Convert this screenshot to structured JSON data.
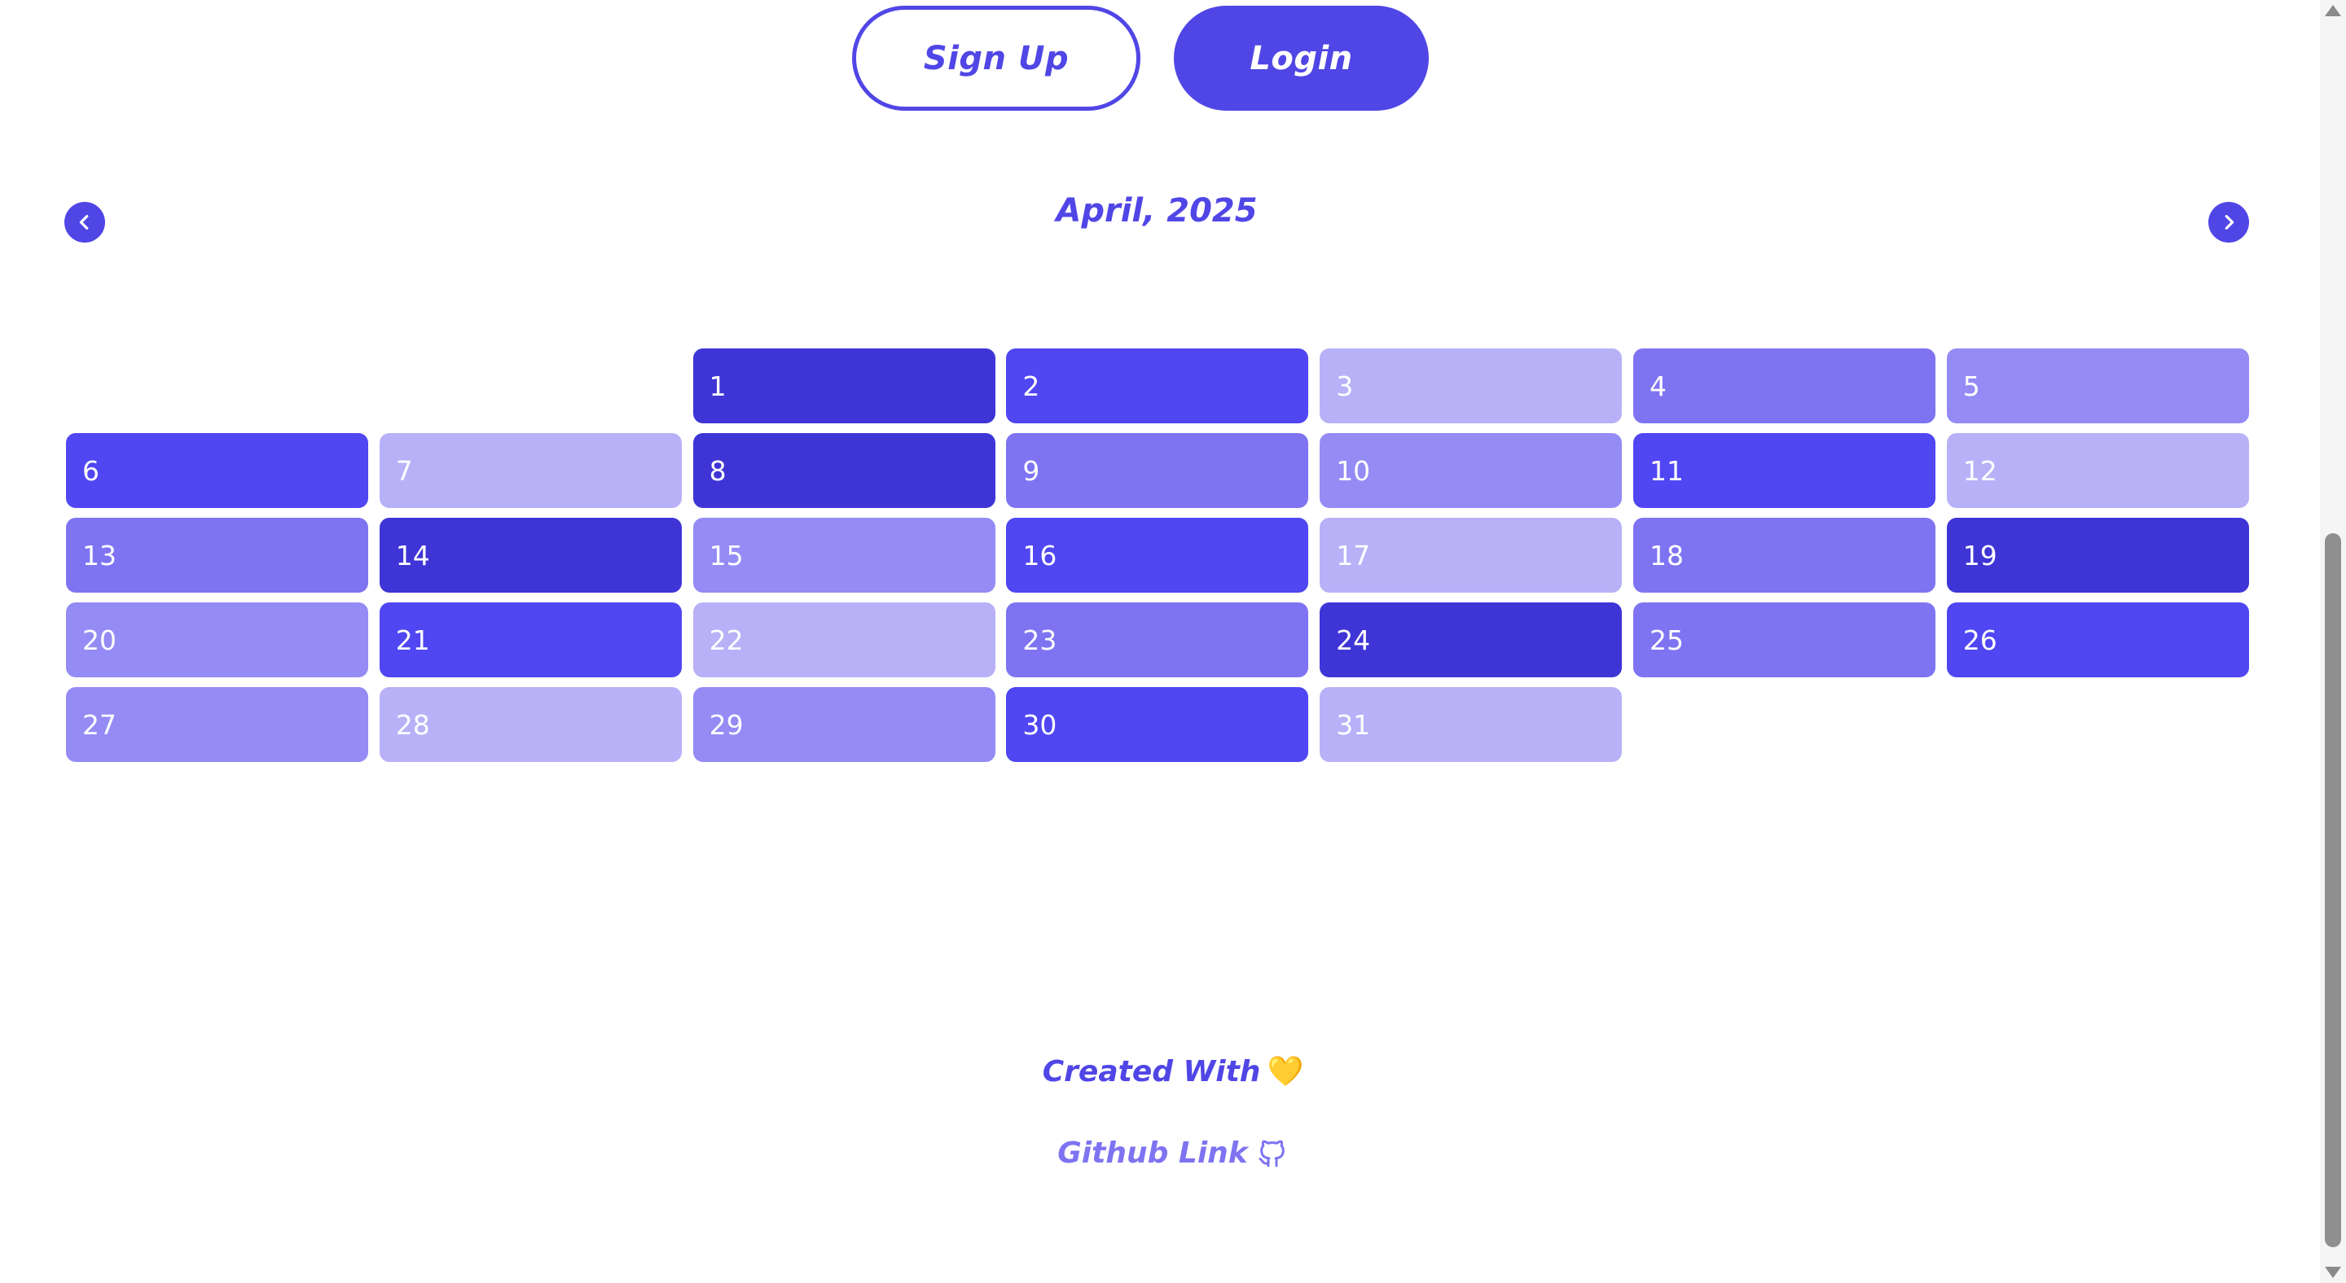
{
  "header": {
    "signup_label": "Sign Up",
    "login_label": "Login"
  },
  "calendar": {
    "title": "April, 2025",
    "prev_icon": "chevron-left-icon",
    "next_icon": "chevron-right-icon",
    "leading_empty": 2,
    "days": [
      {
        "label": "1",
        "level": 5
      },
      {
        "label": "2",
        "level": 4
      },
      {
        "label": "3",
        "level": 1
      },
      {
        "label": "4",
        "level": 3
      },
      {
        "label": "5",
        "level": 2
      },
      {
        "label": "6",
        "level": 4
      },
      {
        "label": "7",
        "level": 1
      },
      {
        "label": "8",
        "level": 5
      },
      {
        "label": "9",
        "level": 3
      },
      {
        "label": "10",
        "level": 2
      },
      {
        "label": "11",
        "level": 4
      },
      {
        "label": "12",
        "level": 1
      },
      {
        "label": "13",
        "level": 3
      },
      {
        "label": "14",
        "level": 5
      },
      {
        "label": "15",
        "level": 2
      },
      {
        "label": "16",
        "level": 4
      },
      {
        "label": "17",
        "level": 1
      },
      {
        "label": "18",
        "level": 3
      },
      {
        "label": "19",
        "level": 5
      },
      {
        "label": "20",
        "level": 2
      },
      {
        "label": "21",
        "level": 4
      },
      {
        "label": "22",
        "level": 1
      },
      {
        "label": "23",
        "level": 3
      },
      {
        "label": "24",
        "level": 5
      },
      {
        "label": "25",
        "level": 3
      },
      {
        "label": "26",
        "level": 4
      },
      {
        "label": "27",
        "level": 2
      },
      {
        "label": "28",
        "level": 1
      },
      {
        "label": "29",
        "level": 2
      },
      {
        "label": "30",
        "level": 4
      },
      {
        "label": "31",
        "level": 1
      }
    ]
  },
  "footer": {
    "created_label": "Created With",
    "heart": "💛",
    "github_label": "Github Link",
    "github_icon": "github-icon"
  },
  "colors": {
    "accent": "#5046e6",
    "level_1": "#b8b1f7",
    "level_2": "#948bf5",
    "level_3": "#7e74f2",
    "level_4": "#5046f2",
    "level_5": "#3f35d6"
  }
}
